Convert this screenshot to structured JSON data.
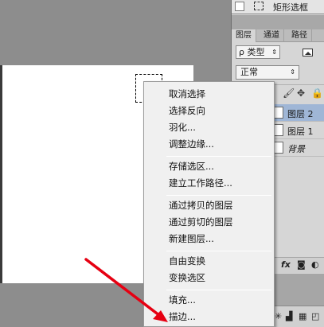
{
  "tool_options": {
    "mode_label": "矩形选框"
  },
  "panel": {
    "tabs": [
      "图层",
      "通道",
      "路径"
    ],
    "kind_filter": {
      "value": "ρ 类型"
    },
    "blend_mode": {
      "value": "正常"
    },
    "layers": [
      {
        "name": "图层 2",
        "selected": true,
        "italic": false
      },
      {
        "name": "图层 1",
        "selected": false,
        "italic": false
      },
      {
        "name": "背景",
        "selected": false,
        "italic": true
      }
    ],
    "footer_fx": "fx"
  },
  "context_menu": {
    "items": [
      "取消选择",
      "选择反向",
      "羽化...",
      "调整边缘...",
      "存储选区...",
      "建立工作路径...",
      "通过拷贝的图层",
      "通过剪切的图层",
      "新建图层...",
      "自由变换",
      "变换选区",
      "填充...",
      "描边..."
    ],
    "highlighted_item": "描边..."
  },
  "annotation": {
    "arrow_color": "#e60012"
  },
  "colors": {
    "menu_bg": "#f0f0f0",
    "workspace_bg": "#8d8d8d",
    "selected_layer": "#9fb6d6"
  }
}
